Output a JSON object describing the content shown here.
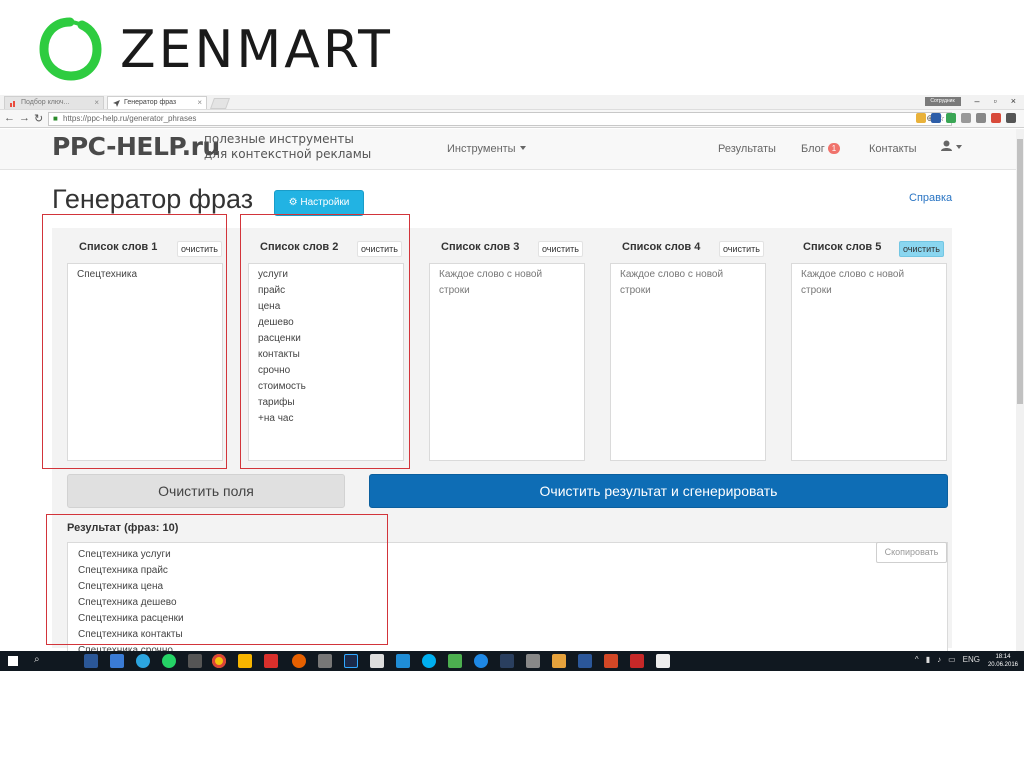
{
  "slide": {
    "logo_text": "ZENMART"
  },
  "browser": {
    "tabs": [
      {
        "label": "Подбор ключ..."
      },
      {
        "label": "Генератор фраз"
      }
    ],
    "profile_label": "Сотрудник",
    "url": "https://ppc-help.ru/generator_phrases"
  },
  "site": {
    "brand": "PPC-HELP.ru",
    "brand_tagline_1": "полезные инструменты",
    "brand_tagline_2": "для контекстной рекламы",
    "nav": {
      "tools": "Инструменты",
      "results": "Результаты",
      "blog": "Блог",
      "blog_badge": "1",
      "contacts": "Контакты"
    }
  },
  "page": {
    "title": "Генератор фраз",
    "settings_button": "Настройки",
    "help_link": "Справка",
    "clear_label": "очистить",
    "lists": [
      {
        "title": "Список слов 1",
        "lines": [
          "Спецтехника"
        ],
        "placeholder": false
      },
      {
        "title": "Список слов 2",
        "lines": [
          "услуги",
          "прайс",
          "цена",
          "дешево",
          "расценки",
          "контакты",
          "срочно",
          "стоимость",
          "тарифы",
          "+на час"
        ],
        "placeholder": false
      },
      {
        "title": "Список слов 3",
        "lines": [
          "Каждое слово с новой",
          "строки"
        ],
        "placeholder": true
      },
      {
        "title": "Список слов 4",
        "lines": [
          "Каждое слово с новой",
          "строки"
        ],
        "placeholder": true
      },
      {
        "title": "Список слов 5",
        "lines": [
          "Каждое слово с новой",
          "строки"
        ],
        "placeholder": true
      }
    ],
    "clear_fields_button": "Очистить поля",
    "generate_button": "Очистить результат и сгенерировать",
    "result_label": "Результат (фраз: 10)",
    "copy_button": "Скопировать",
    "result_lines": [
      "Спецтехника услуги",
      "Спецтехника прайс",
      "Спецтехника цена",
      "Спецтехника дешево",
      "Спецтехника расценки",
      "Спецтехника контакты",
      "Спецтехника срочно"
    ]
  },
  "taskbar": {
    "lang": "ENG",
    "time": "18:14",
    "date": "20.06.2016"
  },
  "colors": {
    "logo_green": "#2ecc40",
    "primary_blue": "#0e6db5",
    "info_blue": "#22b3e3",
    "annotation_red": "#d2343a"
  }
}
